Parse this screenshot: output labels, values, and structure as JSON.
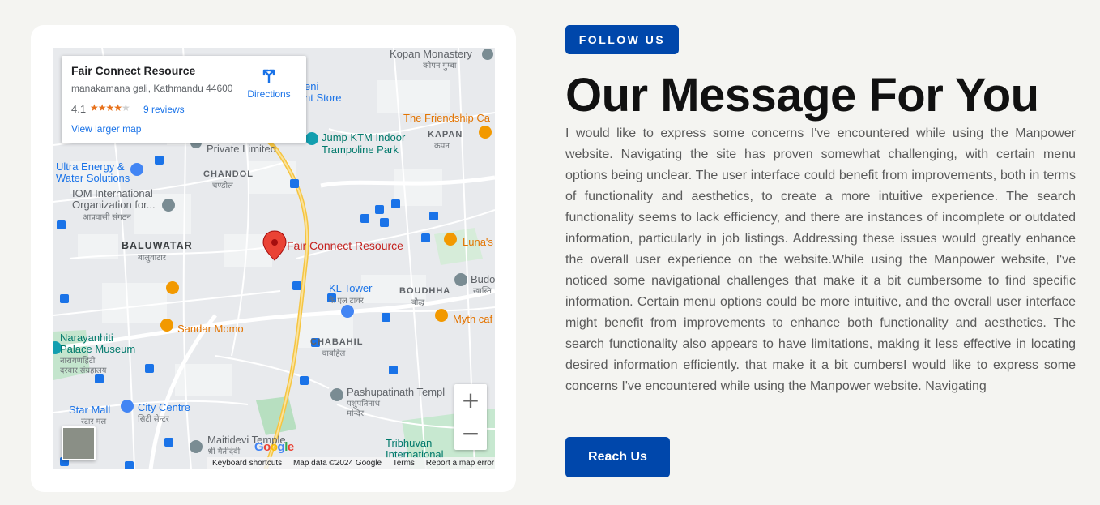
{
  "map": {
    "info": {
      "title": "Fair Connect Resource",
      "address": "manakamana gali, Kathmandu 44600",
      "rating": "4.1",
      "stars_filled": 4,
      "reviews": "9 reviews",
      "larger_map": "View larger map",
      "directions": "Directions"
    },
    "labels": {
      "kopan": "Kopan Monastery",
      "kopan_dev": "कोपन गुम्बा",
      "friendship": "The Friendship Ca",
      "kapan": "KAPAN",
      "kapan_dev": "कपन",
      "jump1": "Jump KTM Indoor",
      "jump2": "Trampoline Park",
      "private": "Private Limited",
      "store1": "eni",
      "store2": "nt Store",
      "ultra1": "Ultra Energy &",
      "ultra2": "Water Solutions",
      "chandol": "CHANDOL",
      "chandol_dev": "चण्डोल",
      "iom1": "IOM International",
      "iom2": "Organization for...",
      "iom_dev": "आप्रवासी संगठन",
      "baluwatar": "BALUWATAR",
      "baluwatar_dev": "बालुवाटार",
      "marker": "Fair Connect Resource",
      "lunas": "Luna's",
      "budo": "Budo",
      "budo_dev": "खास्ति",
      "boudhha": "BOUDHHA",
      "boudhha_dev": "बौद्ध",
      "kltower": "KL Tower",
      "kltower_dev": "के एल टावर",
      "mythcafe": "Myth caf",
      "sandar": "Sandar Momo",
      "narayanhiti1": "Narayanhiti",
      "narayanhiti2": "Palace Museum",
      "narayanhiti_dev1": "नारायणहिटी",
      "narayanhiti_dev2": "दरबार संग्रहालय",
      "chabahil": "CHABAHIL",
      "chabahil_dev": "चाबहिल",
      "pashupati": "Pashupatinath Templ",
      "pashupati_dev1": "पशुपतिनाथ",
      "pashupati_dev2": "मन्दिर",
      "starmall": "Star Mall",
      "starmall_dev": "स्टार मल",
      "citycentre": "City Centre",
      "citycentre_dev": "सिटी सेन्टर",
      "maitidevi": "Maitidevi Temple",
      "maitidevi_dev": "श्री मैतीदेवी",
      "tribhuvan1": "Tribhuvan",
      "tribhuvan2": "International"
    },
    "google_logo": "Google",
    "attribution": {
      "shortcuts": "Keyboard shortcuts",
      "data": "Map data ©2024 Google",
      "terms": "Terms",
      "report": "Report a map error"
    },
    "zoom_in": "+",
    "zoom_out": "−"
  },
  "content": {
    "badge": "FOLLOW US",
    "heading": "Our Message For You",
    "body": "I would like to express some concerns I've encountered while using the Manpower website. Navigating the site has proven somewhat challenging, with certain menu options being unclear. The user interface could benefit from improvements, both in terms of functionality and aesthetics, to create a more intuitive experience. The search functionality seems to lack efficiency, and there are instances of incomplete or outdated information, particularly in job listings. Addressing these issues would greatly enhance the overall user experience on the website.While using the Manpower website, I've noticed some navigational challenges that make it a bit cumbersome to find specific information. Certain menu options could be more intuitive, and the overall user interface might benefit from improvements to enhance both functionality and aesthetics. The search functionality also appears to have limitations, making it less effective in locating desired information efficiently. that make it a bit cumbersI would like to express some concerns I've encountered while using the Manpower website. Navigating",
    "cta": "Reach Us"
  },
  "colors": {
    "accent": "#0047ab",
    "background": "#f4f4f1",
    "marker": "#ea4335"
  }
}
